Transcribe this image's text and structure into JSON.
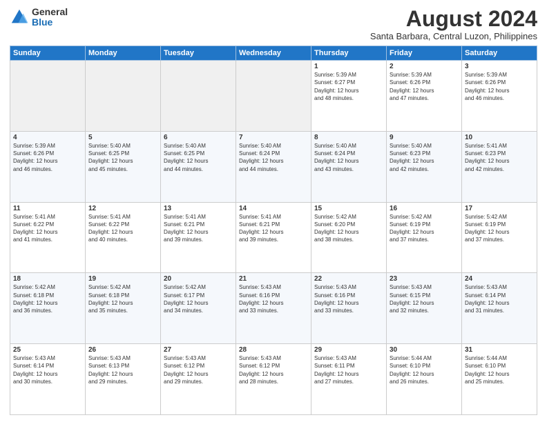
{
  "logo": {
    "general": "General",
    "blue": "Blue"
  },
  "title": "August 2024",
  "subtitle": "Santa Barbara, Central Luzon, Philippines",
  "headers": [
    "Sunday",
    "Monday",
    "Tuesday",
    "Wednesday",
    "Thursday",
    "Friday",
    "Saturday"
  ],
  "weeks": [
    [
      {
        "day": "",
        "info": ""
      },
      {
        "day": "",
        "info": ""
      },
      {
        "day": "",
        "info": ""
      },
      {
        "day": "",
        "info": ""
      },
      {
        "day": "1",
        "info": "Sunrise: 5:39 AM\nSunset: 6:27 PM\nDaylight: 12 hours\nand 48 minutes."
      },
      {
        "day": "2",
        "info": "Sunrise: 5:39 AM\nSunset: 6:26 PM\nDaylight: 12 hours\nand 47 minutes."
      },
      {
        "day": "3",
        "info": "Sunrise: 5:39 AM\nSunset: 6:26 PM\nDaylight: 12 hours\nand 46 minutes."
      }
    ],
    [
      {
        "day": "4",
        "info": "Sunrise: 5:39 AM\nSunset: 6:26 PM\nDaylight: 12 hours\nand 46 minutes."
      },
      {
        "day": "5",
        "info": "Sunrise: 5:40 AM\nSunset: 6:25 PM\nDaylight: 12 hours\nand 45 minutes."
      },
      {
        "day": "6",
        "info": "Sunrise: 5:40 AM\nSunset: 6:25 PM\nDaylight: 12 hours\nand 44 minutes."
      },
      {
        "day": "7",
        "info": "Sunrise: 5:40 AM\nSunset: 6:24 PM\nDaylight: 12 hours\nand 44 minutes."
      },
      {
        "day": "8",
        "info": "Sunrise: 5:40 AM\nSunset: 6:24 PM\nDaylight: 12 hours\nand 43 minutes."
      },
      {
        "day": "9",
        "info": "Sunrise: 5:40 AM\nSunset: 6:23 PM\nDaylight: 12 hours\nand 42 minutes."
      },
      {
        "day": "10",
        "info": "Sunrise: 5:41 AM\nSunset: 6:23 PM\nDaylight: 12 hours\nand 42 minutes."
      }
    ],
    [
      {
        "day": "11",
        "info": "Sunrise: 5:41 AM\nSunset: 6:22 PM\nDaylight: 12 hours\nand 41 minutes."
      },
      {
        "day": "12",
        "info": "Sunrise: 5:41 AM\nSunset: 6:22 PM\nDaylight: 12 hours\nand 40 minutes."
      },
      {
        "day": "13",
        "info": "Sunrise: 5:41 AM\nSunset: 6:21 PM\nDaylight: 12 hours\nand 39 minutes."
      },
      {
        "day": "14",
        "info": "Sunrise: 5:41 AM\nSunset: 6:21 PM\nDaylight: 12 hours\nand 39 minutes."
      },
      {
        "day": "15",
        "info": "Sunrise: 5:42 AM\nSunset: 6:20 PM\nDaylight: 12 hours\nand 38 minutes."
      },
      {
        "day": "16",
        "info": "Sunrise: 5:42 AM\nSunset: 6:19 PM\nDaylight: 12 hours\nand 37 minutes."
      },
      {
        "day": "17",
        "info": "Sunrise: 5:42 AM\nSunset: 6:19 PM\nDaylight: 12 hours\nand 37 minutes."
      }
    ],
    [
      {
        "day": "18",
        "info": "Sunrise: 5:42 AM\nSunset: 6:18 PM\nDaylight: 12 hours\nand 36 minutes."
      },
      {
        "day": "19",
        "info": "Sunrise: 5:42 AM\nSunset: 6:18 PM\nDaylight: 12 hours\nand 35 minutes."
      },
      {
        "day": "20",
        "info": "Sunrise: 5:42 AM\nSunset: 6:17 PM\nDaylight: 12 hours\nand 34 minutes."
      },
      {
        "day": "21",
        "info": "Sunrise: 5:43 AM\nSunset: 6:16 PM\nDaylight: 12 hours\nand 33 minutes."
      },
      {
        "day": "22",
        "info": "Sunrise: 5:43 AM\nSunset: 6:16 PM\nDaylight: 12 hours\nand 33 minutes."
      },
      {
        "day": "23",
        "info": "Sunrise: 5:43 AM\nSunset: 6:15 PM\nDaylight: 12 hours\nand 32 minutes."
      },
      {
        "day": "24",
        "info": "Sunrise: 5:43 AM\nSunset: 6:14 PM\nDaylight: 12 hours\nand 31 minutes."
      }
    ],
    [
      {
        "day": "25",
        "info": "Sunrise: 5:43 AM\nSunset: 6:14 PM\nDaylight: 12 hours\nand 30 minutes."
      },
      {
        "day": "26",
        "info": "Sunrise: 5:43 AM\nSunset: 6:13 PM\nDaylight: 12 hours\nand 29 minutes."
      },
      {
        "day": "27",
        "info": "Sunrise: 5:43 AM\nSunset: 6:12 PM\nDaylight: 12 hours\nand 29 minutes."
      },
      {
        "day": "28",
        "info": "Sunrise: 5:43 AM\nSunset: 6:12 PM\nDaylight: 12 hours\nand 28 minutes."
      },
      {
        "day": "29",
        "info": "Sunrise: 5:43 AM\nSunset: 6:11 PM\nDaylight: 12 hours\nand 27 minutes."
      },
      {
        "day": "30",
        "info": "Sunrise: 5:44 AM\nSunset: 6:10 PM\nDaylight: 12 hours\nand 26 minutes."
      },
      {
        "day": "31",
        "info": "Sunrise: 5:44 AM\nSunset: 6:10 PM\nDaylight: 12 hours\nand 25 minutes."
      }
    ]
  ]
}
